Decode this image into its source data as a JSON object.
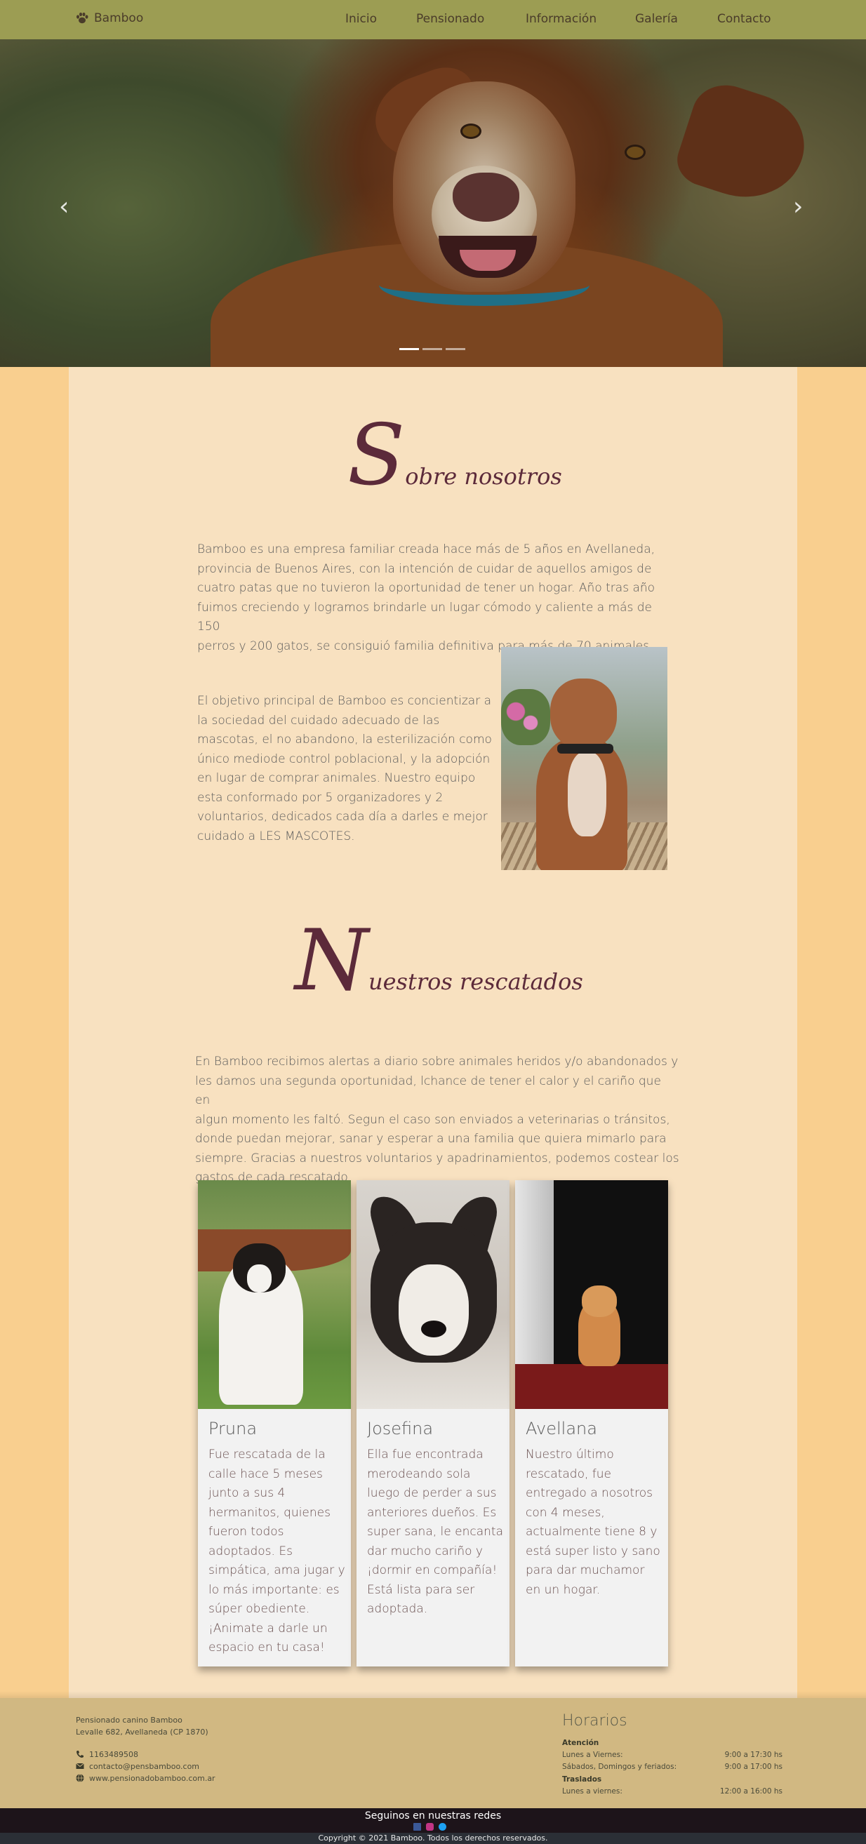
{
  "nav": {
    "brand": "Bamboo",
    "items": [
      "Inicio",
      "Pensionado",
      "Información",
      "Galería",
      "Contacto"
    ]
  },
  "carousel": {
    "prev_symbol": "‹",
    "next_symbol": "›",
    "slides": 3,
    "active_slide": 1
  },
  "about": {
    "title_initial": "S",
    "title_rest": "obre nosotros",
    "para1_lines": [
      "Bamboo es una empresa familiar creada hace más de 5 años en Avellaneda,",
      "provincia de Buenos Aires, con la intención de cuidar de aquellos amigos de",
      "cuatro patas que no tuvieron la oportunidad de tener un hogar. Año tras año",
      "fuimos creciendo y logramos brindarle un lugar cómodo y caliente a más de 150",
      "perros y 200 gatos, se consiguió familia definitiva para más de 70 animales."
    ],
    "para2_lines": [
      "El objetivo principal de Bamboo es concientizar a",
      "la sociedad del cuidado adecuado de las",
      "mascotas, el no abandono, la esterilización como",
      "único mediode control poblacional, y la adopción",
      "en lugar de comprar animales. Nuestro equipo",
      "esta conformado por 5 organizadores y 2",
      "voluntarios, dedicados cada día a darles e mejor",
      "cuidado a LES MASCOTES."
    ]
  },
  "rescued": {
    "title_initial": "N",
    "title_rest": "uestros rescatados",
    "intro_lines": [
      "En Bamboo recibimos alertas a diario sobre animales heridos y/o abandonados y",
      "les damos una segunda oportunidad, lchance de tener el calor y el cariño que en",
      "algun momento les faltó. Segun el caso son enviados a veterinarias o tránsitos,",
      "donde puedan mejorar, sanar y esperar a una familia que quiera mimarlo para",
      "siempre. Gracias a nuestros voluntarios y apadrinamientos, podemos costear los",
      "gastos de cada rescatado."
    ],
    "cards": [
      {
        "name": "Pruna",
        "lines": [
          "Fue rescatada de la",
          "calle hace 5 meses",
          "junto a sus 4",
          "hermanitos, quienes",
          "fueron todos",
          "adoptados. Es",
          "simpática, ama jugar y",
          "lo más importante: es",
          "súper obediente.",
          "¡Animate a darle un",
          "espacio en tu casa!"
        ]
      },
      {
        "name": "Josefina",
        "lines": [
          "Ella fue encontrada",
          "merodeando sola",
          "luego de perder a sus",
          "anteriores dueños. Es",
          "super sana, le encanta",
          "dar mucho cariño y",
          "¡dormir en compañía!",
          "Está lista para ser",
          "adoptada."
        ]
      },
      {
        "name": "Avellana",
        "lines": [
          "Nuestro último",
          "rescatado, fue",
          "entregado a nosotros",
          "con 4 meses,",
          "actualmente tiene 8 y",
          "está super listo y sano",
          "para dar muchamor",
          "en un hogar."
        ]
      }
    ]
  },
  "footer": {
    "business_name": "Pensionado canino Bamboo",
    "address": "Levalle 682, Avellaneda (CP 1870)",
    "phone": "1163489508",
    "email": "contacto@pensbamboo.com",
    "website": "www.pensionadobamboo.com.ar",
    "hours_title": "Horarios",
    "attention_label": "Atención",
    "attention_rows": [
      {
        "days": "Lunes a Viernes:",
        "time": "9:00 a 17:30 hs"
      },
      {
        "days": "Sábados, Domingos y feriados:",
        "time": "9:00 a 17:00 hs"
      }
    ],
    "transfers_label": "Traslados",
    "transfer_rows": [
      {
        "days": "Lunes a viernes:",
        "time": "12:00 a 16:00 hs"
      }
    ],
    "social_title": "Seguinos en nuestras redes",
    "copyright": "Copyright © 2021 Bamboo. Todos los derechos reservados."
  },
  "colors": {
    "nav": "#9c9d53",
    "page_bg": "#f9cf8f",
    "panel_bg": "#f8e1c0",
    "title": "#5c2a3a",
    "footer": "#d1b882",
    "social_bar": "#1d141a",
    "copyright_bar": "#2b2f36"
  },
  "icons": [
    "paw-icon",
    "chevron-left-icon",
    "chevron-right-icon",
    "phone-icon",
    "envelope-icon",
    "globe-icon",
    "facebook-icon",
    "instagram-icon",
    "twitter-icon"
  ]
}
